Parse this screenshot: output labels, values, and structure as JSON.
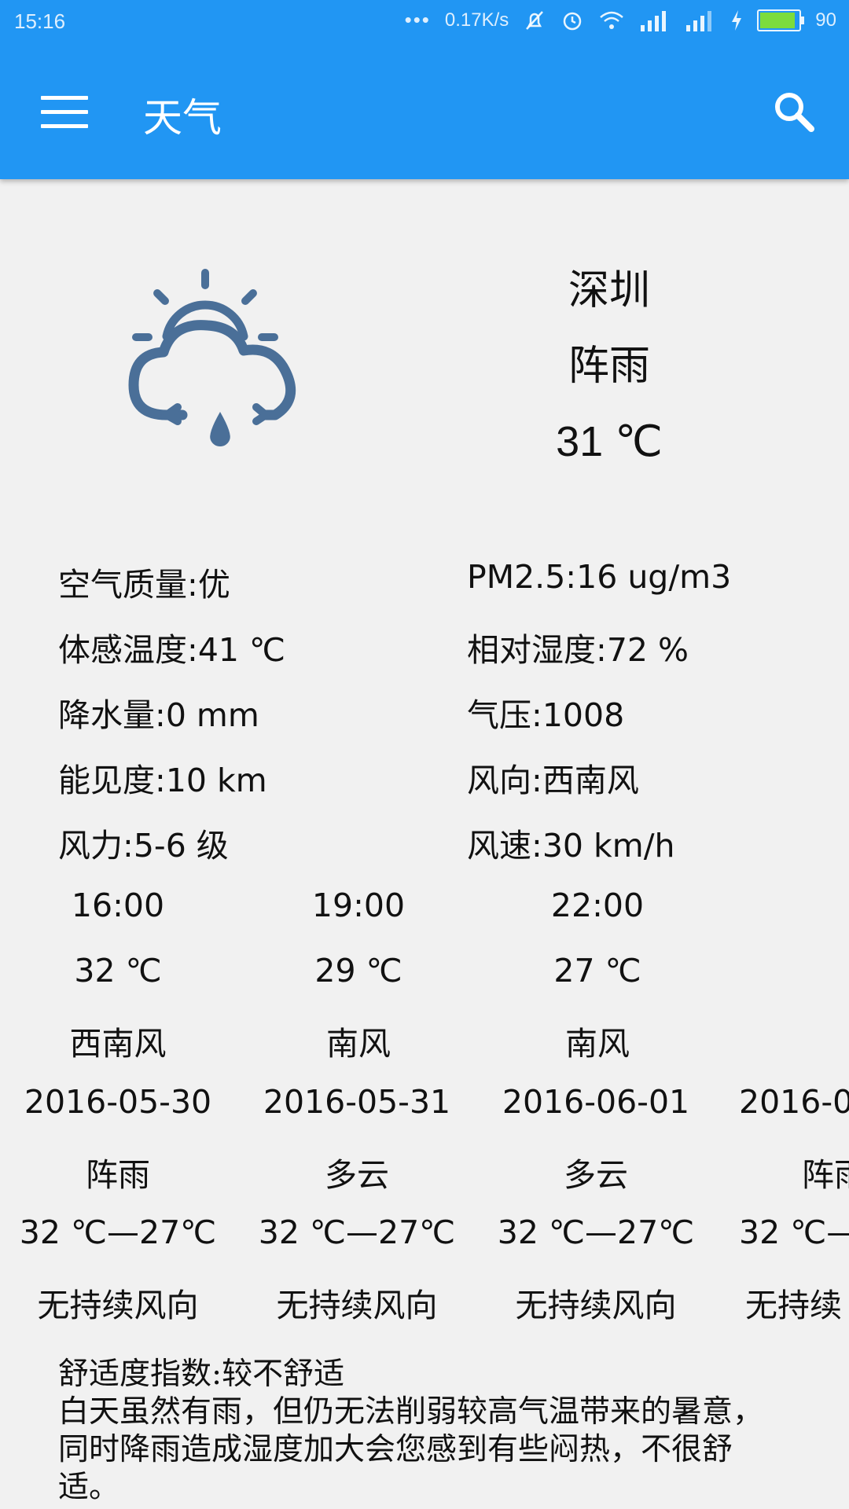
{
  "statusbar": {
    "time": "15:16",
    "speed": "0.17K/s",
    "battery": "90"
  },
  "appbar": {
    "title": "天气",
    "menu_icon": "menu-icon",
    "search_icon": "search-icon",
    "color": "#2196f3"
  },
  "current": {
    "icon": "sun-cloud-rain-icon",
    "city": "深圳",
    "condition": "阵雨",
    "temperature": "31 ℃"
  },
  "details": [
    {
      "left": "空气质量:优",
      "right": "PM2.5:16 ug/m3"
    },
    {
      "left": "体感温度:41 ℃",
      "right": "相对湿度:72 %"
    },
    {
      "left": "降水量:0 mm",
      "right": "气压:1008"
    },
    {
      "left": "能见度:10 km",
      "right": "风向:西南风"
    },
    {
      "left": "风力:5-6 级",
      "right": "风速:30 km/h"
    }
  ],
  "hourly": [
    {
      "time": "16:00",
      "temp": "32 ℃",
      "wind": "西南风"
    },
    {
      "time": "19:00",
      "temp": "29 ℃",
      "wind": "南风"
    },
    {
      "time": "22:00",
      "temp": "27 ℃",
      "wind": "南风"
    }
  ],
  "daily": [
    {
      "date": "2016-05-30",
      "condition": "阵雨",
      "temp": "32 ℃—27℃",
      "wind": "无持续风向"
    },
    {
      "date": "2016-05-31",
      "condition": "多云",
      "temp": "32 ℃—27℃",
      "wind": "无持续风向"
    },
    {
      "date": "2016-06-01",
      "condition": "多云",
      "temp": "32 ℃—27℃",
      "wind": "无持续风向"
    },
    {
      "date": "2016-0",
      "condition": "阵雨",
      "temp": "32 ℃—",
      "wind": "无持续"
    }
  ],
  "comfort": {
    "title": "舒适度指数:较不舒适",
    "text": "白天虽然有雨，但仍无法削弱较高气温带来的暑意，同时降雨造成湿度加大会您感到有些闷热，不很舒适。"
  }
}
